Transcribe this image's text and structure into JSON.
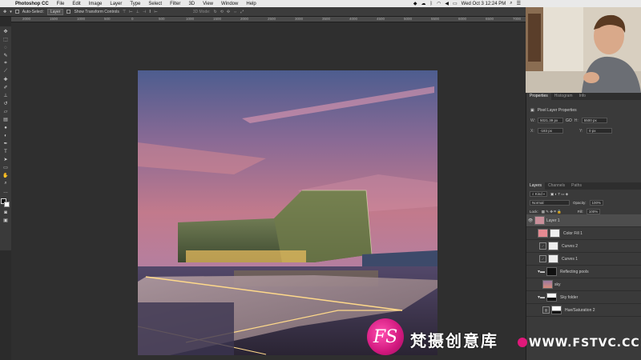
{
  "menubar": {
    "app_name": "Photoshop CC",
    "items": [
      "File",
      "Edit",
      "Image",
      "Layer",
      "Type",
      "Select",
      "Filter",
      "3D",
      "View",
      "Window",
      "Help"
    ],
    "clock": "Wed Oct 3  12:24 PM"
  },
  "options_bar": {
    "auto_select_label": "Auto-Select:",
    "auto_select_value": "Layer",
    "transform_label": "Show Transform Controls",
    "mode_label": "3D Mode:"
  },
  "rulers": {
    "top_ticks": [
      "2000",
      "1500",
      "1000",
      "500",
      "0",
      "500",
      "1000",
      "1500",
      "2000",
      "2500",
      "3000",
      "3500",
      "4000",
      "4500",
      "5000",
      "5500",
      "6000",
      "6500",
      "7000"
    ]
  },
  "properties_panel": {
    "tabs": [
      "Properties",
      "Histogram",
      "Info"
    ],
    "title": "Pixel Layer Properties",
    "w_label": "W:",
    "w_value": "5021.39 px",
    "go_label": "GO",
    "h_label": "H:",
    "h_value": "5500 px",
    "x_label": "X:",
    "x_value": "-183 px",
    "y_label": "Y:",
    "y_value": "0 px"
  },
  "layers_panel": {
    "tabs": [
      "Layers",
      "Channels",
      "Paths"
    ],
    "kind_label": "Kind",
    "blend_mode": "Normal",
    "opacity_label": "Opacity:",
    "opacity_value": "100%",
    "lock_label": "Lock:",
    "fill_label": "Fill:",
    "fill_value": "100%",
    "layers": [
      {
        "name": "Layer 1",
        "type": "pixel",
        "selected": true
      },
      {
        "name": "Color Fill 1",
        "type": "fill"
      },
      {
        "name": "Curves 2",
        "type": "adjustment"
      },
      {
        "name": "Curves 1",
        "type": "adjustment"
      },
      {
        "name": "Reflecting pools",
        "type": "group"
      },
      {
        "name": "sky",
        "type": "pixel"
      },
      {
        "name": "Sky folder",
        "type": "group"
      },
      {
        "name": "Hue/Saturation 2",
        "type": "adjustment"
      }
    ]
  },
  "watermark": {
    "logo_letter": "FS",
    "text": "梵摄创意库",
    "url": "WWW.FSTVC.CC"
  },
  "colors": {
    "panel_bg": "#3a3a3a",
    "canvas_bg": "#2f2f2f",
    "accent": "#d1187e"
  }
}
